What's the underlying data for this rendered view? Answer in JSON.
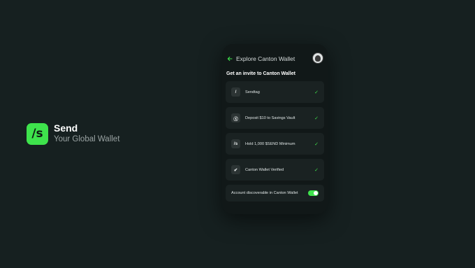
{
  "brand": {
    "logo_text": "/s",
    "name": "Send",
    "tagline": "Your Global Wallet",
    "accent": "#3ee34c"
  },
  "screen": {
    "title": "Explore Canton Wallet",
    "back_icon": "arrow-left-icon",
    "avatar": "profile-avatar",
    "section_title": "Get an invite to Canton Wallet",
    "requirements": [
      {
        "icon_text": "/",
        "icon": "slash-icon",
        "label": "Sendtag",
        "completed": true
      },
      {
        "icon_text": "Ⓢ",
        "icon": "coin-icon",
        "label": "Deposit $10 to Savings Vault",
        "completed": true
      },
      {
        "icon_text": "/s",
        "icon": "send-logo-icon",
        "label": "Hold 1,000 $SEND Minimum",
        "completed": true
      },
      {
        "icon_text": "✔",
        "icon": "verified-badge-icon",
        "label": "Canton Wallet Verified",
        "completed": true
      }
    ],
    "toggle": {
      "label": "Account discoverable in Canton Wallet",
      "on": true
    }
  },
  "colors": {
    "background": "#162020",
    "card": "#111818",
    "row": "#1a2222",
    "check": "#3ee34c"
  }
}
